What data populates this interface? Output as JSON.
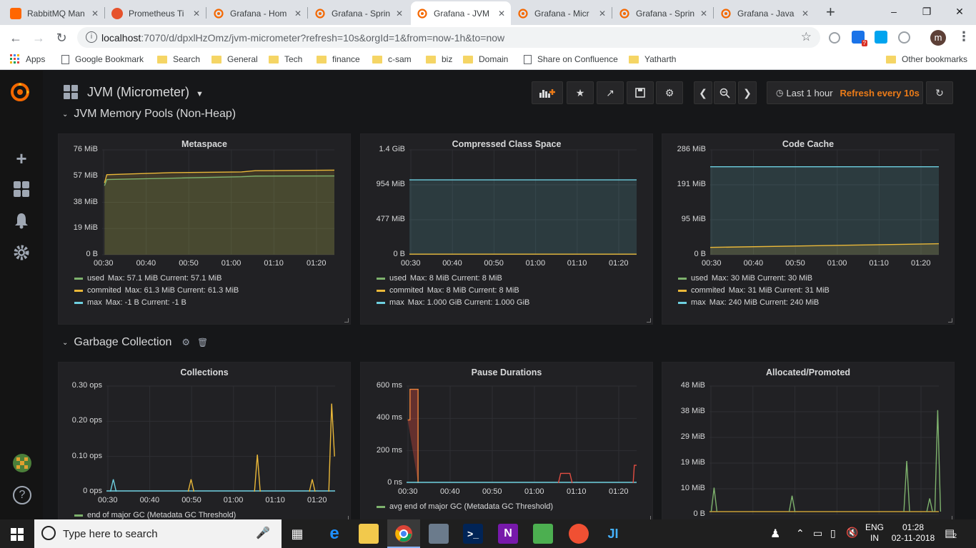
{
  "browser": {
    "tabs": [
      {
        "label": "RabbitMQ Man",
        "icon": "rabbitmq-icon",
        "color": "#ff6600",
        "active": false
      },
      {
        "label": "Prometheus Ti",
        "icon": "prometheus-icon",
        "color": "#e6522c",
        "active": false
      },
      {
        "label": "Grafana - Hom",
        "icon": "grafana-icon",
        "color": "#f46800",
        "active": false
      },
      {
        "label": "Grafana - Sprin",
        "icon": "grafana-icon",
        "color": "#f46800",
        "active": false
      },
      {
        "label": "Grafana - JVM",
        "icon": "grafana-icon",
        "color": "#f46800",
        "active": true
      },
      {
        "label": "Grafana - Micr",
        "icon": "grafana-icon",
        "color": "#f46800",
        "active": false
      },
      {
        "label": "Grafana - Sprin",
        "icon": "grafana-icon",
        "color": "#f46800",
        "active": false
      },
      {
        "label": "Grafana - Java",
        "icon": "grafana-icon",
        "color": "#f46800",
        "active": false
      }
    ],
    "new_tab_label": "+",
    "url_host": "localhost",
    "url_path": ":7070/d/dpxlHzOmz/jvm-micrometer?refresh=10s&orgId=1&from=now-1h&to=now",
    "profile_initial": "m",
    "extension_badge": "?",
    "bookmarks": [
      {
        "label": "Apps",
        "type": "apps"
      },
      {
        "label": "Google Bookmark",
        "type": "page"
      },
      {
        "label": "Search",
        "type": "folder"
      },
      {
        "label": "General",
        "type": "folder"
      },
      {
        "label": "Tech",
        "type": "folder"
      },
      {
        "label": "finance",
        "type": "folder"
      },
      {
        "label": "c-sam",
        "type": "folder"
      },
      {
        "label": "biz",
        "type": "folder"
      },
      {
        "label": "Domain",
        "type": "folder"
      },
      {
        "label": "Share on Confluence",
        "type": "page"
      },
      {
        "label": "Yatharth",
        "type": "folder"
      }
    ],
    "other_bookmarks": "Other bookmarks"
  },
  "grafana": {
    "dashboard_title": "JVM (Micrometer)",
    "time_range": "Last 1 hour",
    "refresh": "Refresh every 10s",
    "accent": "#eb7b18",
    "rows": {
      "non_heap": "JVM Memory Pools (Non-Heap)",
      "gc": "Garbage Collection"
    }
  },
  "panels": [
    {
      "title": "Metaspace",
      "yticks": [
        "76 MiB",
        "57 MiB",
        "38 MiB",
        "19 MiB",
        "0 B"
      ],
      "xticks": [
        "00:30",
        "00:40",
        "00:50",
        "01:00",
        "01:10",
        "01:20"
      ],
      "legend": [
        {
          "name": "used",
          "stats": "Max: 57.1 MiB  Current: 57.1 MiB",
          "color": "#7eb26d"
        },
        {
          "name": "commited",
          "stats": "Max: 61.3 MiB  Current: 61.3 MiB",
          "color": "#eab839"
        },
        {
          "name": "max",
          "stats": "Max: -1 B  Current: -1 B",
          "color": "#6ed0e0"
        }
      ]
    },
    {
      "title": "Compressed Class Space",
      "yticks": [
        "1.4 GiB",
        "954 MiB",
        "477 MiB",
        "0 B"
      ],
      "xticks": [
        "00:30",
        "00:40",
        "00:50",
        "01:00",
        "01:10",
        "01:20"
      ],
      "legend": [
        {
          "name": "used",
          "stats": "Max: 8 MiB  Current: 8 MiB",
          "color": "#7eb26d"
        },
        {
          "name": "commited",
          "stats": "Max: 8 MiB  Current: 8 MiB",
          "color": "#eab839"
        },
        {
          "name": "max",
          "stats": "Max: 1.000 GiB  Current: 1.000 GiB",
          "color": "#6ed0e0"
        }
      ]
    },
    {
      "title": "Code Cache",
      "yticks": [
        "286 MiB",
        "191 MiB",
        "95 MiB",
        "0 B"
      ],
      "xticks": [
        "00:30",
        "00:40",
        "00:50",
        "01:00",
        "01:10",
        "01:20"
      ],
      "legend": [
        {
          "name": "used",
          "stats": "Max: 30 MiB  Current: 30 MiB",
          "color": "#7eb26d"
        },
        {
          "name": "commited",
          "stats": "Max: 31 MiB  Current: 31 MiB",
          "color": "#eab839"
        },
        {
          "name": "max",
          "stats": "Max: 240 MiB  Current: 240 MiB",
          "color": "#6ed0e0"
        }
      ]
    },
    {
      "title": "Collections",
      "yticks": [
        "0.30 ops",
        "0.20 ops",
        "0.10 ops",
        "0 ops"
      ],
      "xticks": [
        "00:30",
        "00:40",
        "00:50",
        "01:00",
        "01:10",
        "01:20"
      ],
      "legend": [
        {
          "name": "end of major GC (Metadata GC Threshold)",
          "stats": "",
          "color": "#7eb26d"
        }
      ]
    },
    {
      "title": "Pause Durations",
      "yticks": [
        "600 ms",
        "400 ms",
        "200 ms",
        "0 ns"
      ],
      "xticks": [
        "00:30",
        "00:40",
        "00:50",
        "01:00",
        "01:10",
        "01:20"
      ],
      "legend": [
        {
          "name": "avg end of major GC (Metadata GC Threshold)",
          "stats": "",
          "color": "#7eb26d"
        }
      ]
    },
    {
      "title": "Allocated/Promoted",
      "yticks": [
        "48 MiB",
        "38 MiB",
        "29 MiB",
        "19 MiB",
        "10 MiB",
        "0 B"
      ],
      "xticks": [],
      "legend": []
    }
  ],
  "chart_data": [
    {
      "type": "area",
      "title": "Metaspace",
      "x": [
        "00:28",
        "00:29",
        "00:40",
        "01:00",
        "01:05",
        "01:28"
      ],
      "series": [
        {
          "name": "used",
          "values": [
            50,
            54.5,
            55.5,
            56.5,
            57,
            57.1
          ]
        },
        {
          "name": "commited",
          "values": [
            52,
            58,
            59.5,
            60,
            60.9,
            61.3
          ]
        },
        {
          "name": "max",
          "values": [
            -1,
            -1,
            -1,
            -1,
            -1,
            -1
          ]
        }
      ],
      "ylim": [
        0,
        76
      ]
    },
    {
      "type": "area",
      "title": "Compressed Class Space",
      "x": [
        "00:28",
        "01:28"
      ],
      "series": [
        {
          "name": "used",
          "values": [
            8,
            8
          ]
        },
        {
          "name": "commited",
          "values": [
            8,
            8
          ]
        },
        {
          "name": "max",
          "values": [
            1024,
            1024
          ]
        }
      ],
      "ylim": [
        0,
        1434
      ]
    },
    {
      "type": "area",
      "title": "Code Cache",
      "x": [
        "00:28",
        "01:28"
      ],
      "series": [
        {
          "name": "used",
          "values": [
            20,
            30
          ]
        },
        {
          "name": "commited",
          "values": [
            21,
            31
          ]
        },
        {
          "name": "max",
          "values": [
            240,
            240
          ]
        }
      ],
      "ylim": [
        0,
        286
      ]
    },
    {
      "type": "line",
      "title": "Collections",
      "x": [
        "00:31",
        "00:44",
        "01:04",
        "01:18",
        "01:27"
      ],
      "series": [
        {
          "name": "end of major GC (Metadata GC Threshold)",
          "values": [
            0.035,
            0.035,
            0.105,
            0.035,
            0.25
          ]
        }
      ],
      "ylim": [
        0,
        0.3
      ]
    },
    {
      "type": "line",
      "title": "Pause Durations",
      "x": [
        "00:29",
        "00:30",
        "01:09",
        "01:28"
      ],
      "series": [
        {
          "name": "avg end of major GC (Metadata GC Threshold)",
          "values": [
            390,
            580,
            60,
            110
          ]
        }
      ],
      "ylim": [
        0,
        600
      ]
    },
    {
      "type": "line",
      "title": "Allocated/Promoted",
      "x": [
        "00:30",
        "00:47",
        "01:05",
        "01:21",
        "01:26"
      ],
      "series": [
        {
          "name": "",
          "values": [
            10,
            7,
            20,
            6,
            39
          ]
        }
      ],
      "ylim": [
        0,
        48
      ]
    }
  ],
  "taskbar": {
    "search_placeholder": "Type here to search",
    "lang": "ENG",
    "region": "IN",
    "time": "01:28",
    "date": "02-11-2018",
    "notif_count": "2"
  }
}
